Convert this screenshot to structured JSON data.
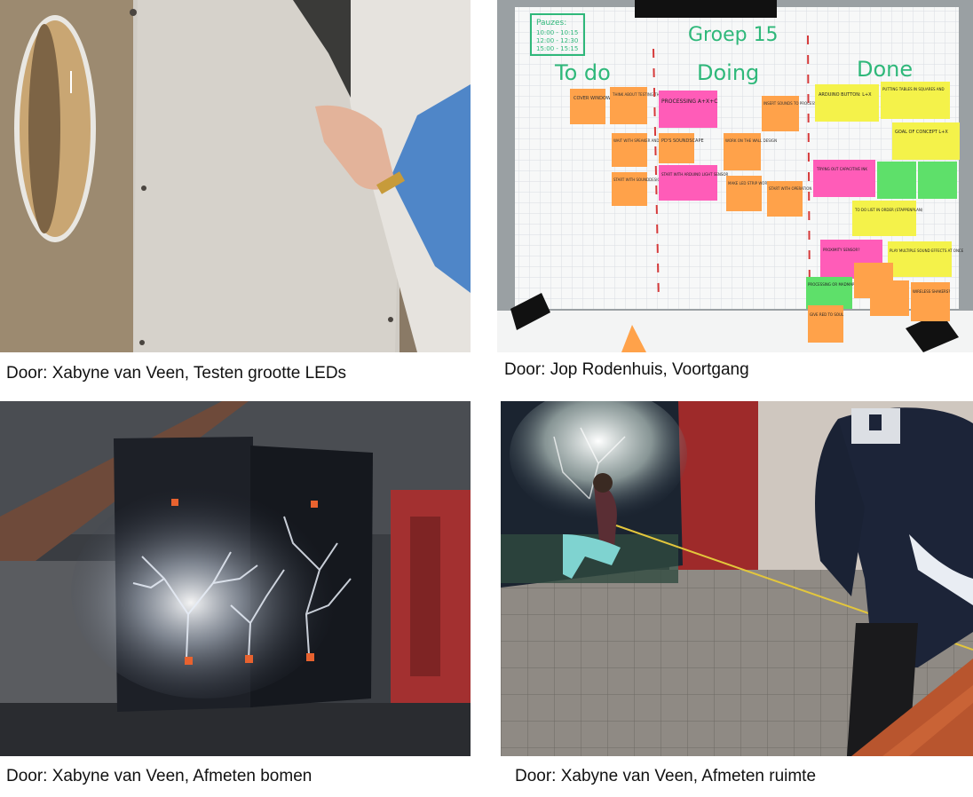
{
  "photos": [
    {
      "caption": "Door: Xabyne van Veen, Testen grootte LEDs"
    },
    {
      "caption": "Door: Jop Rodenhuis, Voortgang",
      "board": {
        "title": "Groep 15",
        "pauzes_label": "Pauzes:",
        "pauzes": [
          "10:00 - 10:15",
          "12:00 - 12:30",
          "15:00 - 15:15"
        ],
        "columns": [
          "To do",
          "Doing",
          "Done"
        ],
        "notes": {
          "todo": [
            "COVER WINDOWS",
            "THINK ABOUT TESTING THE SERES",
            "WAIT WITH SPEAKER AND HEADPHONES",
            "START WITH SOUNDDESIGN"
          ],
          "doing": [
            "PROCESSING A+X+C",
            "INSERT SOUNDS TO PROCESSING",
            "PD'S SOUNDSCAPE",
            "WORK ON THE WALL DESIGN",
            "START WITH ARDUINO LIGHT SENSOR",
            "MAKE LED STRIP WORK",
            "START WITH OPERATION"
          ],
          "done": [
            "ARDUINO BUTTON: L+X",
            "PUTTING TABLES IN SQUARES AND",
            "GOAL OF CONCEPT L+X",
            "TRYING OUT CAPACITIVE INK",
            "TO DO LIST IN ORDER (STAPPENPLAN)",
            "PROXIMITY SENSOR?",
            "PLAY MULTIPLE SOUND EFFECTS AT ONCE",
            "PROCESSING OR MADMAPPER",
            "GIVE RED TO SOUL",
            "WIRELESS SHAKERS?"
          ]
        }
      }
    },
    {
      "caption": "Door: Xabyne van Veen, Afmeten bomen"
    },
    {
      "caption": "Door: Xabyne van Veen, Afmeten ruimte"
    }
  ],
  "colors": {
    "note_orange": "#ffa24a",
    "note_pink": "#ff5cb8",
    "note_yellow": "#f4f24a",
    "note_green": "#5ee06a",
    "marker_green": "#2fb87a",
    "marker_red": "#d63a3a"
  }
}
